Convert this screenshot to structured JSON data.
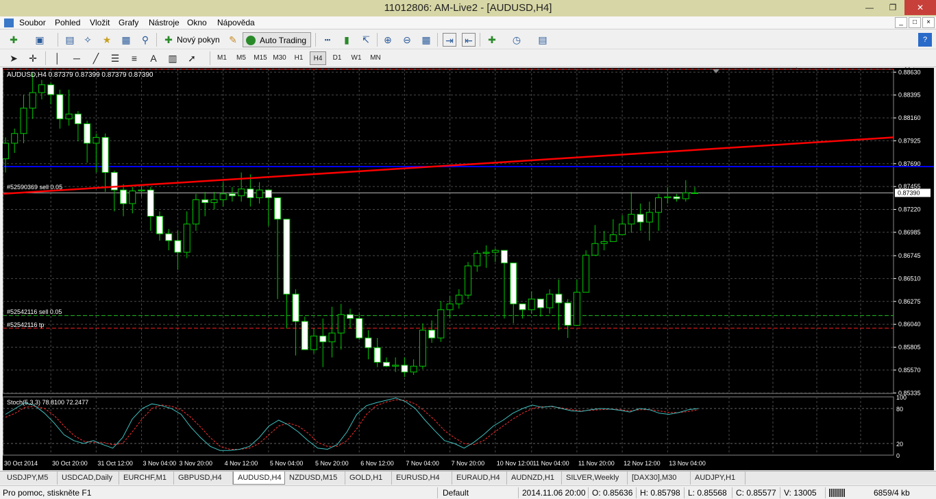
{
  "window": {
    "title": "11012806: AM-Live2 - [AUDUSD,H4]",
    "min": "—",
    "restore": "❐",
    "close": "✕"
  },
  "menu": [
    "Soubor",
    "Pohled",
    "Vložit",
    "Grafy",
    "Nástroje",
    "Okno",
    "Nápověda"
  ],
  "toolbar": {
    "new_order": "Nový pokyn",
    "auto_trading": "Auto Trading",
    "search_placeholder": ""
  },
  "timeframes": [
    "M1",
    "M5",
    "M15",
    "M30",
    "H1",
    "H4",
    "D1",
    "W1",
    "MN"
  ],
  "active_timeframe": "H4",
  "chart": {
    "header": "AUDUSD,H4  0.87379 0.87399 0.87379 0.87390",
    "price_labels": [
      "0.88630",
      "0.88395",
      "0.88160",
      "0.87925",
      "0.87690",
      "0.87455",
      "0.87220",
      "0.86985",
      "0.86745",
      "0.86510",
      "0.86275",
      "0.86040",
      "0.85805",
      "0.85570",
      "0.85335"
    ],
    "current_price": "0.87390",
    "order_labels": [
      "#52590369 sell 0.05",
      "#52542116 sell 0.05",
      "#52542116 tp"
    ],
    "time_labels": [
      "30 Oct 2014",
      "30 Oct 20:00",
      "31 Oct 12:00",
      "3 Nov 04:00",
      "3 Nov 20:00",
      "4 Nov 12:00",
      "5 Nov 04:00",
      "5 Nov 20:00",
      "6 Nov 12:00",
      "7 Nov 04:00",
      "7 Nov 20:00",
      "10 Nov 12:00",
      "11 Nov 04:00",
      "11 Nov 20:00",
      "12 Nov 12:00",
      "13 Nov 04:00"
    ],
    "stoch_header": "Stoch(5,3,3) 78.8100 72.2477",
    "stoch_labels": [
      "100",
      "80",
      "20",
      "0"
    ],
    "colors": {
      "bg": "#000000",
      "grid": "#4a4a4a",
      "bull": "#000000",
      "bear": "#ffffff",
      "wick": "#00cc00",
      "trend": "#ff0000",
      "hline": "#0000ff",
      "main": "#40c0c0",
      "signal": "#ff3030"
    }
  },
  "chart_data": {
    "type": "candlestick",
    "symbol": "AUDUSD",
    "timeframe": "H4",
    "ylim": [
      0.8533,
      0.8866
    ],
    "open": [
      0.8774,
      0.879,
      0.88,
      0.8826,
      0.8842,
      0.885,
      0.884,
      0.8815,
      0.882,
      0.881,
      0.879,
      0.8796,
      0.876,
      0.8742,
      0.8728,
      0.8741,
      0.8742,
      0.8715,
      0.8697,
      0.869,
      0.8678,
      0.8707,
      0.8732,
      0.8729,
      0.8732,
      0.8738,
      0.8736,
      0.8743,
      0.8734,
      0.8742,
      0.8734,
      0.8712,
      0.8635,
      0.8607,
      0.8578,
      0.8592,
      0.8586,
      0.8595,
      0.8614,
      0.861,
      0.859,
      0.858,
      0.8565,
      0.8561,
      0.8562,
      0.8555,
      0.8561,
      0.8598,
      0.859,
      0.8619,
      0.8625,
      0.8634,
      0.8664,
      0.8677,
      0.8678,
      0.868,
      0.8667,
      0.8625,
      0.8619,
      0.863,
      0.8621,
      0.8635,
      0.8626,
      0.8603,
      0.8637,
      0.8675,
      0.8687,
      0.8689,
      0.8696,
      0.8707,
      0.8717,
      0.8709,
      0.8719,
      0.8734,
      0.8735,
      0.8733,
      0.8739
    ],
    "close": [
      0.879,
      0.88,
      0.8826,
      0.8842,
      0.885,
      0.884,
      0.8815,
      0.882,
      0.881,
      0.879,
      0.8796,
      0.876,
      0.8742,
      0.8728,
      0.8741,
      0.8742,
      0.8715,
      0.8697,
      0.869,
      0.8678,
      0.8707,
      0.8732,
      0.8729,
      0.8732,
      0.8738,
      0.8736,
      0.8743,
      0.8734,
      0.8742,
      0.8734,
      0.8712,
      0.8635,
      0.8607,
      0.8578,
      0.8592,
      0.8586,
      0.8595,
      0.8614,
      0.861,
      0.859,
      0.858,
      0.8565,
      0.8561,
      0.8562,
      0.8555,
      0.8561,
      0.8598,
      0.859,
      0.8619,
      0.8625,
      0.8634,
      0.8664,
      0.8677,
      0.8678,
      0.868,
      0.8667,
      0.8625,
      0.8619,
      0.863,
      0.8621,
      0.8635,
      0.8626,
      0.8603,
      0.8637,
      0.8675,
      0.8687,
      0.8689,
      0.8696,
      0.8707,
      0.8717,
      0.8709,
      0.8719,
      0.8734,
      0.8735,
      0.8733,
      0.8739,
      0.8739
    ],
    "high": [
      0.8796,
      0.8805,
      0.884,
      0.8862,
      0.8855,
      0.8852,
      0.8845,
      0.8845,
      0.8823,
      0.8813,
      0.88,
      0.88,
      0.8762,
      0.8748,
      0.8745,
      0.8748,
      0.8745,
      0.872,
      0.8702,
      0.87,
      0.872,
      0.8738,
      0.874,
      0.874,
      0.875,
      0.8745,
      0.876,
      0.8758,
      0.875,
      0.874,
      0.873,
      0.8712,
      0.864,
      0.8612,
      0.86,
      0.861,
      0.8622,
      0.8625,
      0.862,
      0.8615,
      0.8598,
      0.859,
      0.857,
      0.857,
      0.857,
      0.8568,
      0.8605,
      0.8608,
      0.8628,
      0.8633,
      0.864,
      0.8668,
      0.868,
      0.8685,
      0.8682,
      0.867,
      0.8635,
      0.8625,
      0.8638,
      0.863,
      0.864,
      0.865,
      0.863,
      0.865,
      0.868,
      0.8706,
      0.87,
      0.8712,
      0.8716,
      0.874,
      0.8728,
      0.873,
      0.8738,
      0.8745,
      0.8738,
      0.8752,
      0.8745
    ],
    "low": [
      0.876,
      0.878,
      0.879,
      0.8815,
      0.8835,
      0.883,
      0.8805,
      0.8808,
      0.8792,
      0.877,
      0.876,
      0.874,
      0.872,
      0.8715,
      0.8718,
      0.8735,
      0.87,
      0.869,
      0.868,
      0.866,
      0.8672,
      0.87,
      0.8715,
      0.8722,
      0.8725,
      0.873,
      0.873,
      0.8725,
      0.8728,
      0.8705,
      0.863,
      0.86,
      0.8572,
      0.8578,
      0.8574,
      0.856,
      0.857,
      0.8578,
      0.86,
      0.8588,
      0.8568,
      0.856,
      0.856,
      0.8555,
      0.855,
      0.8552,
      0.8558,
      0.8585,
      0.8586,
      0.861,
      0.862,
      0.863,
      0.8658,
      0.8662,
      0.8668,
      0.861,
      0.8605,
      0.861,
      0.8615,
      0.8612,
      0.8615,
      0.8598,
      0.859,
      0.863,
      0.867,
      0.8682,
      0.868,
      0.869,
      0.87,
      0.8698,
      0.87,
      0.869,
      0.87,
      0.8728,
      0.873,
      0.873,
      0.8738
    ],
    "trendline": [
      0.8738,
      0.8796
    ],
    "hline_blue": 0.8766,
    "order_levels": {
      "sell_52590369": 0.8866,
      "sell_52542116": 0.8613,
      "tp_52542116": 0.86
    },
    "stoch_main": [
      70,
      80,
      90,
      85,
      72,
      55,
      35,
      25,
      20,
      25,
      18,
      12,
      30,
      62,
      80,
      88,
      85,
      80,
      70,
      48,
      30,
      15,
      8,
      8,
      10,
      15,
      30,
      50,
      60,
      52,
      40,
      25,
      12,
      10,
      18,
      40,
      70,
      85,
      90,
      94,
      98,
      92,
      80,
      60,
      42,
      25,
      20,
      12,
      22,
      35,
      50,
      60,
      72,
      80,
      86,
      82,
      84,
      80,
      76,
      75,
      78,
      80,
      79,
      77,
      74,
      80,
      78,
      72,
      70,
      73,
      78,
      80
    ],
    "stoch_signal": [
      65,
      72,
      82,
      84,
      80,
      68,
      50,
      34,
      24,
      22,
      22,
      18,
      20,
      40,
      62,
      80,
      86,
      84,
      78,
      65,
      48,
      30,
      15,
      10,
      10,
      12,
      20,
      35,
      50,
      55,
      50,
      38,
      22,
      15,
      15,
      25,
      45,
      70,
      85,
      91,
      95,
      94,
      88,
      75,
      60,
      42,
      30,
      20,
      18,
      25,
      38,
      50,
      62,
      72,
      80,
      83,
      83,
      81,
      78,
      76,
      77,
      78,
      79,
      78,
      76,
      78,
      78,
      76,
      73,
      73,
      75,
      78
    ],
    "stoch_ylim": [
      0,
      100
    ]
  },
  "chart_tabs": [
    "USDJPY,M5",
    "USDCAD,Daily",
    "EURCHF,M1",
    "GBPUSD,H4",
    "AUDUSD,H4",
    "NZDUSD,M15",
    "GOLD,H1",
    "EURUSD,H4",
    "EURAUD,H4",
    "AUDNZD,H1",
    "SILVER,Weekly",
    "[DAX30],M30",
    "AUDJPY,H1"
  ],
  "active_tab": "AUDUSD,H4",
  "status": {
    "help": "Pro pomoc, stiskněte F1",
    "profile": "Default",
    "datetime": "2014.11.06 20:00",
    "open": "O: 0.85636",
    "high": "H: 0.85798",
    "low": "L: 0.85568",
    "close": "C: 0.85577",
    "volume": "V: 13005",
    "traffic": "6859/4 kb"
  }
}
